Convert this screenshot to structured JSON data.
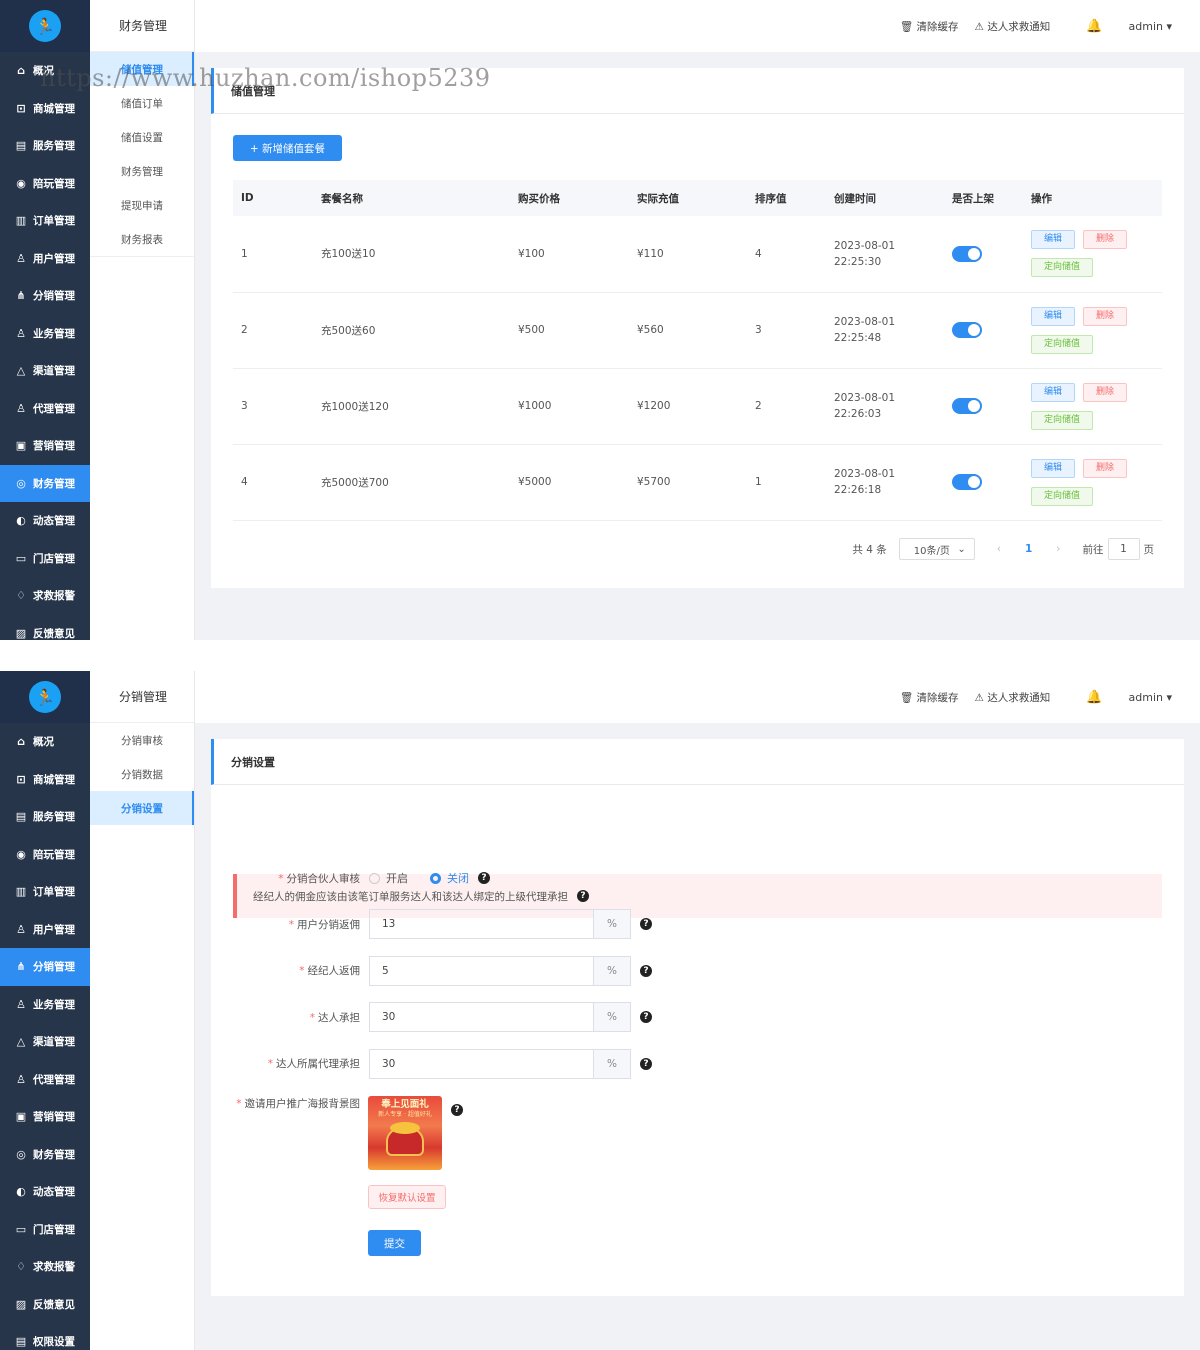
{
  "brand": {
    "logo_icon": "running-person-logo"
  },
  "topbar": {
    "clear_cache": "清除缓存",
    "rescue_notice": "达人求救通知",
    "user": "admin"
  },
  "screen1": {
    "nav": [
      {
        "label": "概况",
        "icon": "⌂"
      },
      {
        "label": "商城管理",
        "icon": "⊡"
      },
      {
        "label": "服务管理",
        "icon": "▤"
      },
      {
        "label": "陪玩管理",
        "icon": "◉"
      },
      {
        "label": "订单管理",
        "icon": "▥"
      },
      {
        "label": "用户管理",
        "icon": "♙"
      },
      {
        "label": "分销管理",
        "icon": "⋔"
      },
      {
        "label": "业务管理",
        "icon": "♙"
      },
      {
        "label": "渠道管理",
        "icon": "△"
      },
      {
        "label": "代理管理",
        "icon": "♙"
      },
      {
        "label": "营销管理",
        "icon": "▣"
      },
      {
        "label": "财务管理",
        "icon": "◎"
      },
      {
        "label": "动态管理",
        "icon": "◐"
      },
      {
        "label": "门店管理",
        "icon": "▭"
      },
      {
        "label": "求救报警",
        "icon": "♢"
      },
      {
        "label": "反馈意见",
        "icon": "▨"
      }
    ],
    "sub_title": "财务管理",
    "sub_items": [
      "储值管理",
      "储值订单",
      "储值设置",
      "财务管理",
      "提现申请",
      "财务报表"
    ],
    "card_title": "储值管理",
    "add_button": "+ 新增储值套餐",
    "columns": [
      "ID",
      "套餐名称",
      "购买价格",
      "实际充值",
      "排序值",
      "创建时间",
      "是否上架",
      "操作"
    ],
    "rows": [
      {
        "id": "1",
        "name": "充100送10",
        "price": "¥100",
        "actual": "¥110",
        "sort": "4",
        "date": "2023-08-01",
        "time": "22:25:30"
      },
      {
        "id": "2",
        "name": "充500送60",
        "price": "¥500",
        "actual": "¥560",
        "sort": "3",
        "date": "2023-08-01",
        "time": "22:25:48"
      },
      {
        "id": "3",
        "name": "充1000送120",
        "price": "¥1000",
        "actual": "¥1200",
        "sort": "2",
        "date": "2023-08-01",
        "time": "22:26:03"
      },
      {
        "id": "4",
        "name": "充5000送700",
        "price": "¥5000",
        "actual": "¥5700",
        "sort": "1",
        "date": "2023-08-01",
        "time": "22:26:18"
      }
    ],
    "actions": {
      "edit": "编辑",
      "delete": "删除",
      "directed": "定向储值"
    },
    "pagination": {
      "total": "共 4 条",
      "page_size": "10条/页",
      "current": "1",
      "goto": "前往",
      "page_input": "1",
      "page_unit": "页"
    },
    "watermark": "https://www.huzhan.com/ishop5239"
  },
  "screen2": {
    "nav": [
      {
        "label": "概况",
        "icon": "⌂"
      },
      {
        "label": "商城管理",
        "icon": "⊡"
      },
      {
        "label": "服务管理",
        "icon": "▤"
      },
      {
        "label": "陪玩管理",
        "icon": "◉"
      },
      {
        "label": "订单管理",
        "icon": "▥"
      },
      {
        "label": "用户管理",
        "icon": "♙"
      },
      {
        "label": "分销管理",
        "icon": "⋔"
      },
      {
        "label": "业务管理",
        "icon": "♙"
      },
      {
        "label": "渠道管理",
        "icon": "△"
      },
      {
        "label": "代理管理",
        "icon": "♙"
      },
      {
        "label": "营销管理",
        "icon": "▣"
      },
      {
        "label": "财务管理",
        "icon": "◎"
      },
      {
        "label": "动态管理",
        "icon": "◐"
      },
      {
        "label": "门店管理",
        "icon": "▭"
      },
      {
        "label": "求救报警",
        "icon": "♢"
      },
      {
        "label": "反馈意见",
        "icon": "▨"
      },
      {
        "label": "权限设置",
        "icon": "▤"
      }
    ],
    "sub_title": "分销管理",
    "sub_items": [
      "分销审核",
      "分销数据",
      "分销设置"
    ],
    "card_title": "分销设置",
    "alert": "经纪人的佣金应该由该笔订单服务达人和该达人绑定的上级代理承担",
    "audit_label": "分销合伙人审核",
    "audit_on": "开启",
    "audit_off": "关闭",
    "fields": [
      {
        "label": "用户分销返佣",
        "value": "13",
        "unit": "%"
      },
      {
        "label": "经纪人返佣",
        "value": "5",
        "unit": "%"
      },
      {
        "label": "达人承担",
        "value": "30",
        "unit": "%"
      },
      {
        "label": "达人所属代理承担",
        "value": "30",
        "unit": "%"
      }
    ],
    "poster_label": "邀请用户推广海报背景图",
    "poster_title": "奉上见面礼",
    "poster_sub": "新人专享 · 超值好礼",
    "reset_button": "恢复默认设置",
    "submit_button": "提交"
  }
}
